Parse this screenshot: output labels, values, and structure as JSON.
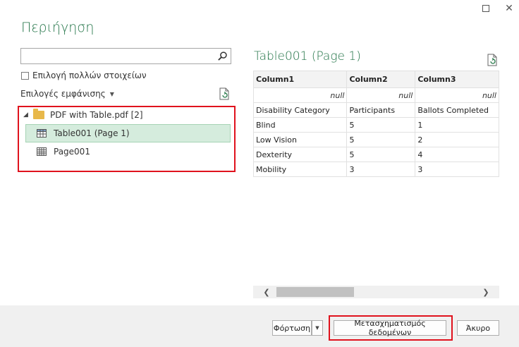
{
  "window": {
    "title": "Περιήγηση",
    "maximize_icon": "maximize-icon",
    "close_label": "✕"
  },
  "navigator": {
    "search": {
      "value": "",
      "placeholder": ""
    },
    "multi_select_label": "Επιλογή πολλών στοιχείων",
    "view_options_label": "Επιλογές εμφάνισης",
    "tree": {
      "root": {
        "label": "PDF with Table.pdf [2]",
        "expanded": true
      },
      "children": [
        {
          "label": "Table001 (Page 1)",
          "selected": true
        },
        {
          "label": "Page001",
          "selected": false
        }
      ]
    }
  },
  "preview": {
    "title": "Table001 (Page 1)",
    "columns": [
      "Column1",
      "Column2",
      "Column3"
    ],
    "rows": [
      [
        "null",
        "null",
        "null"
      ],
      [
        "Disability Category",
        "Participants",
        "Ballots Completed"
      ],
      [
        "Blind",
        "5",
        "1"
      ],
      [
        "Low Vision",
        "5",
        "2"
      ],
      [
        "Dexterity",
        "5",
        "4"
      ],
      [
        "Mobility",
        "3",
        "3"
      ]
    ],
    "scroll_left": "❮",
    "scroll_right": "❯"
  },
  "footer": {
    "load_label": "Φόρτωση",
    "load_dropdown": "▼",
    "transform_label": "Μετασχηματισμός δεδομένων",
    "cancel_label": "Άκυρο"
  },
  "colors": {
    "accent": "#217346",
    "highlight": "#e0121d",
    "selection": "#d5ecdd"
  }
}
